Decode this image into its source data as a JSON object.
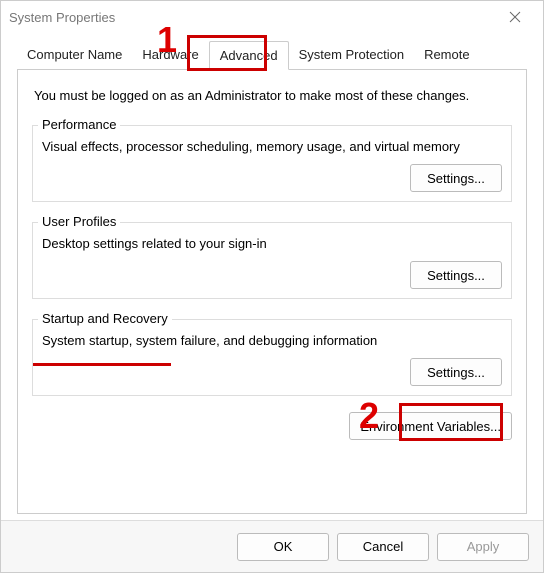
{
  "window": {
    "title": "System Properties"
  },
  "tabs": {
    "computer_name": "Computer Name",
    "hardware": "Hardware",
    "advanced": "Advanced",
    "system_protection": "System Protection",
    "remote": "Remote"
  },
  "advanced_tab": {
    "intro": "You must be logged on as an Administrator to make most of these changes.",
    "performance": {
      "legend": "Performance",
      "desc": "Visual effects, processor scheduling, memory usage, and virtual memory",
      "button": "Settings..."
    },
    "user_profiles": {
      "legend": "User Profiles",
      "desc": "Desktop settings related to your sign-in",
      "button": "Settings..."
    },
    "startup_recovery": {
      "legend": "Startup and Recovery",
      "desc": "System startup, system failure, and debugging information",
      "button": "Settings..."
    },
    "env_vars_button": "Environment Variables..."
  },
  "footer": {
    "ok": "OK",
    "cancel": "Cancel",
    "apply": "Apply"
  },
  "annotations": {
    "num1": "1",
    "num2": "2",
    "highlight_colors": {
      "box": "#c00",
      "text": "#d00"
    }
  }
}
